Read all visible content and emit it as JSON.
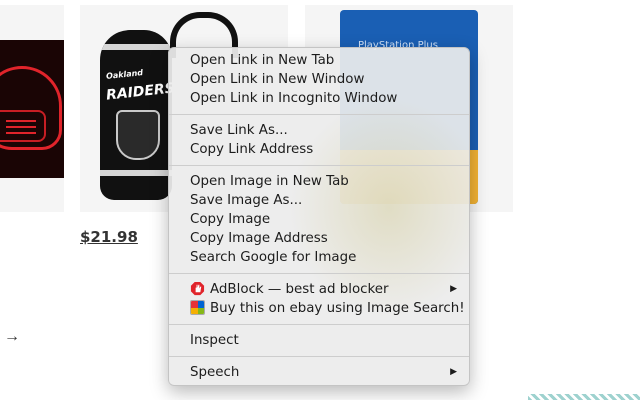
{
  "page": {
    "price": "$21.98",
    "next_arrow_icon": "arrow-right-icon"
  },
  "products": {
    "backpack_text": "RAIDERS",
    "backpack_small_text": "Oakland",
    "card_text": "PlayStation Plus"
  },
  "context_menu": {
    "groups": [
      [
        "Open Link in New Tab",
        "Open Link in New Window",
        "Open Link in Incognito Window"
      ],
      [
        "Save Link As...",
        "Copy Link Address"
      ],
      [
        "Open Image in New Tab",
        "Save Image As...",
        "Copy Image",
        "Copy Image Address",
        "Search Google for Image"
      ],
      [
        "AdBlock — best ad blocker",
        "Buy this on ebay using Image Search!"
      ],
      [
        "Inspect"
      ],
      [
        "Speech"
      ]
    ],
    "submenu_arrow": "▶",
    "icons": {
      "adblock": "adblock-hand-icon",
      "ebay": "ebay-image-search-icon"
    },
    "colors": {
      "menu_bg": "#ececec",
      "adblock_red": "#e0242b"
    }
  }
}
